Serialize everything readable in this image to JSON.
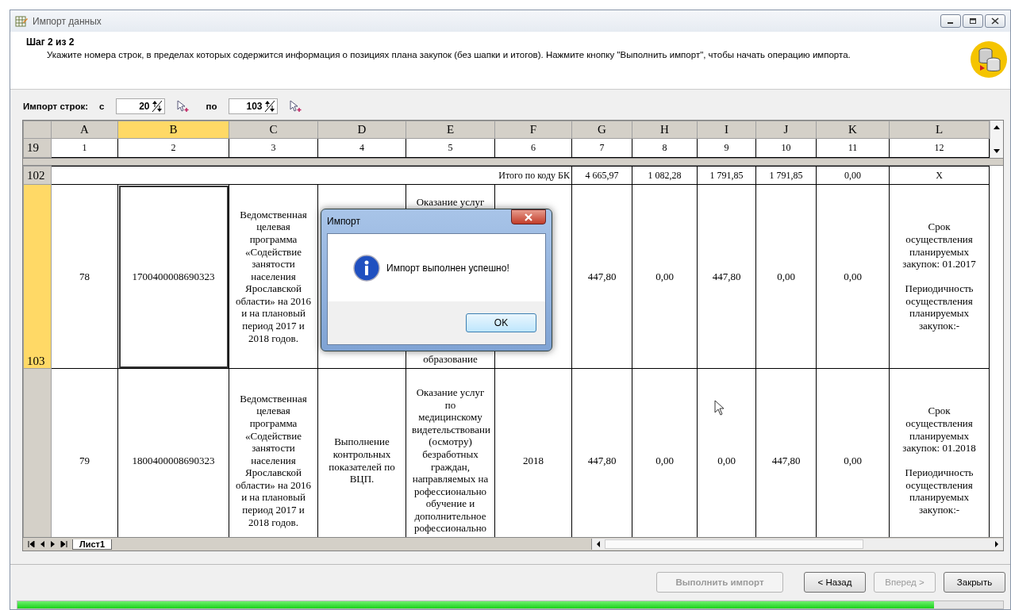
{
  "window": {
    "title": "Импорт данных"
  },
  "header": {
    "step": "Шаг 2 из 2",
    "description": "Укажите номера строк, в пределах которых содержится информация о позициях плана закупок (без шапки и итогов). Нажмите кнопку \"Выполнить импорт\", чтобы начать операцию импорта."
  },
  "range": {
    "label": "Импорт строк:",
    "from_label": "с",
    "from_value": "20",
    "to_label": "по",
    "to_value": "103"
  },
  "grid": {
    "columns": [
      {
        "label": "A",
        "selected": false
      },
      {
        "label": "B",
        "selected": true
      },
      {
        "label": "C",
        "selected": false
      },
      {
        "label": "D",
        "selected": false
      },
      {
        "label": "E",
        "selected": false
      },
      {
        "label": "F",
        "selected": false
      },
      {
        "label": "G",
        "selected": false
      },
      {
        "label": "H",
        "selected": false
      },
      {
        "label": "I",
        "selected": false
      },
      {
        "label": "J",
        "selected": false
      },
      {
        "label": "K",
        "selected": false
      },
      {
        "label": "L",
        "selected": false
      }
    ],
    "header_row": {
      "header": "19",
      "cells": [
        "1",
        "2",
        "3",
        "4",
        "5",
        "6",
        "7",
        "8",
        "9",
        "10",
        "11",
        "12"
      ]
    },
    "rows": [
      {
        "kind": "total",
        "header": "102",
        "selected": false,
        "label": "Итого по коду БК",
        "values": [
          "4 665,97",
          "1 082,28",
          "1 791,85",
          "1 791,85",
          "0,00",
          "X"
        ]
      },
      {
        "kind": "data",
        "header": "103",
        "selected": true,
        "cells": [
          "78",
          "1700400008690323",
          "Ведомственная целевая программа «Содействие занятости населения Ярославской области» на 2016 и на плановый период 2017 и 2018 годов.",
          null,
          {
            "top": "Оказание услуг",
            "bottom": "образование"
          },
          null,
          "447,80",
          "0,00",
          "447,80",
          "0,00",
          "0,00",
          "Срок осуществления планируемых закупок: 01.2017\n\nПериодичность осуществления планируемых закупок:-"
        ]
      },
      {
        "kind": "data",
        "selected": false,
        "cells": [
          "79",
          "1800400008690323",
          "Ведомственная целевая программа «Содействие занятости населения Ярославской области» на 2016 и на плановый период 2017 и 2018 годов.",
          "Выполнение контрольных показателей по ВЦП.",
          "Оказание услуг по медицинскому видетельствовани (осмотру) безработных граждан, направляемых на рофессионально обучение и дополнительное рофессионально",
          "2018",
          "447,80",
          "0,00",
          "0,00",
          "447,80",
          "0,00",
          "Срок осуществления планируемых закупок: 01.2018\n\nПериодичность осуществления планируемых закупок:-"
        ]
      }
    ],
    "sheet_tabs": [
      {
        "label": "Лист1",
        "selected": true
      }
    ]
  },
  "dialog": {
    "title": "Импорт",
    "message": "Импорт выполнен успешно!",
    "button": "OK"
  },
  "buttons": [
    {
      "label": "Выполнить импорт",
      "disabled": true
    },
    {
      "label": "< Назад",
      "disabled": false
    },
    {
      "label": "Вперед >",
      "disabled": true
    },
    {
      "label": "Закрыть",
      "disabled": false
    }
  ],
  "progress": {
    "level": 0.93
  }
}
